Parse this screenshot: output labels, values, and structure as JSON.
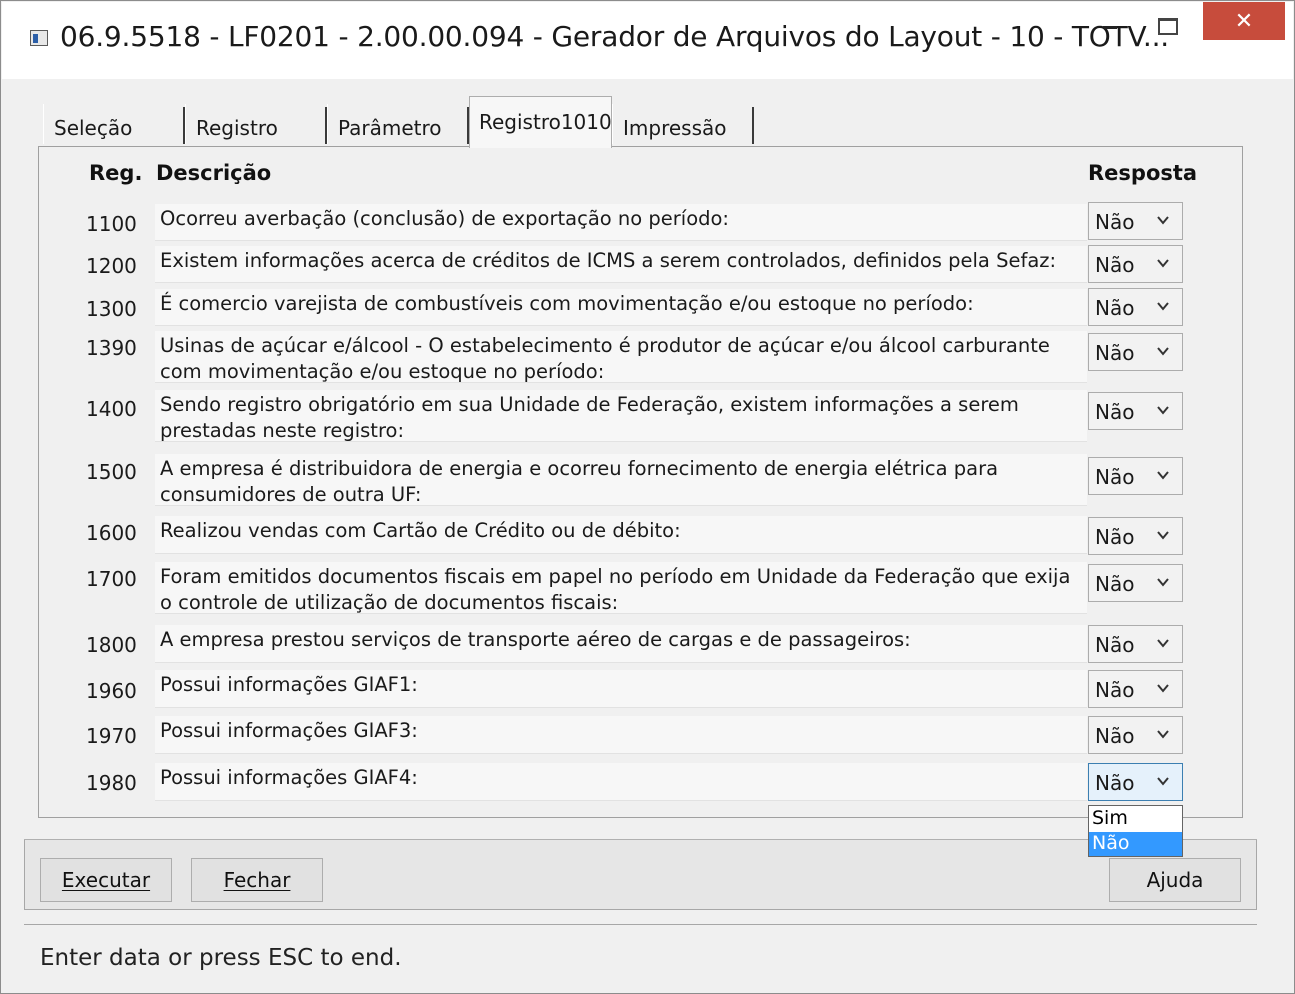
{
  "window": {
    "title": "06.9.5518 - LF0201 - 2.00.00.094 - Gerador de Arquivos do Layout - 10 - TOTV...",
    "close_symbol": "✕"
  },
  "tabs": [
    {
      "label": "Seleção"
    },
    {
      "label": "Registro"
    },
    {
      "label": "Parâmetro"
    },
    {
      "label": "Registro1010"
    },
    {
      "label": "Impressão"
    }
  ],
  "active_tab": "Registro1010",
  "table": {
    "headers": {
      "reg": "Reg.",
      "desc": "Descrição",
      "resp": "Resposta"
    },
    "rows": [
      {
        "code": "1100",
        "desc": "Ocorreu averbação (conclusão) de exportação no período:",
        "answer": "Não"
      },
      {
        "code": "1200",
        "desc": "Existem informações acerca de créditos de ICMS a serem controlados, definidos pela Sefaz:",
        "answer": "Não"
      },
      {
        "code": "1300",
        "desc": "É comercio varejista de combustíveis com movimentação e/ou estoque no período:",
        "answer": "Não"
      },
      {
        "code": "1390",
        "desc": "Usinas de açúcar e/álcool - O estabelecimento é produtor de açúcar e/ou álcool carburante com movimentação e/ou estoque no período:",
        "answer": "Não"
      },
      {
        "code": "1400",
        "desc": "Sendo registro obrigatório em sua Unidade de Federação, existem informações a serem prestadas neste registro:",
        "answer": "Não"
      },
      {
        "code": "1500",
        "desc": "A empresa é distribuidora de energia e ocorreu fornecimento de energia elétrica para consumidores de outra UF:",
        "answer": "Não"
      },
      {
        "code": "1600",
        "desc": "Realizou vendas com Cartão de Crédito ou de débito:",
        "answer": "Não"
      },
      {
        "code": "1700",
        "desc": "Foram emitidos documentos fiscais em papel no período em Unidade da Federação que exija o controle de utilização de documentos fiscais:",
        "answer": "Não"
      },
      {
        "code": "1800",
        "desc": "A empresa prestou serviços de transporte aéreo de cargas e de passageiros:",
        "answer": "Não"
      },
      {
        "code": "1960",
        "desc": "Possui informações GIAF1:",
        "answer": "Não"
      },
      {
        "code": "1970",
        "desc": "Possui informações GIAF3:",
        "answer": "Não"
      },
      {
        "code": "1980",
        "desc": "Possui informações GIAF4:",
        "answer": "Não"
      }
    ]
  },
  "dropdown": {
    "options": [
      "Sim",
      "Não"
    ],
    "highlighted": "Não"
  },
  "buttons": {
    "execute": "Executar",
    "close": "Fechar",
    "help": "Ajuda"
  },
  "status_bar": {
    "text": "Enter data or press ESC to end."
  },
  "colors": {
    "close_button": "#c74c3c",
    "selection_highlight": "#3399ff",
    "focus_border": "#3c7fb1"
  }
}
